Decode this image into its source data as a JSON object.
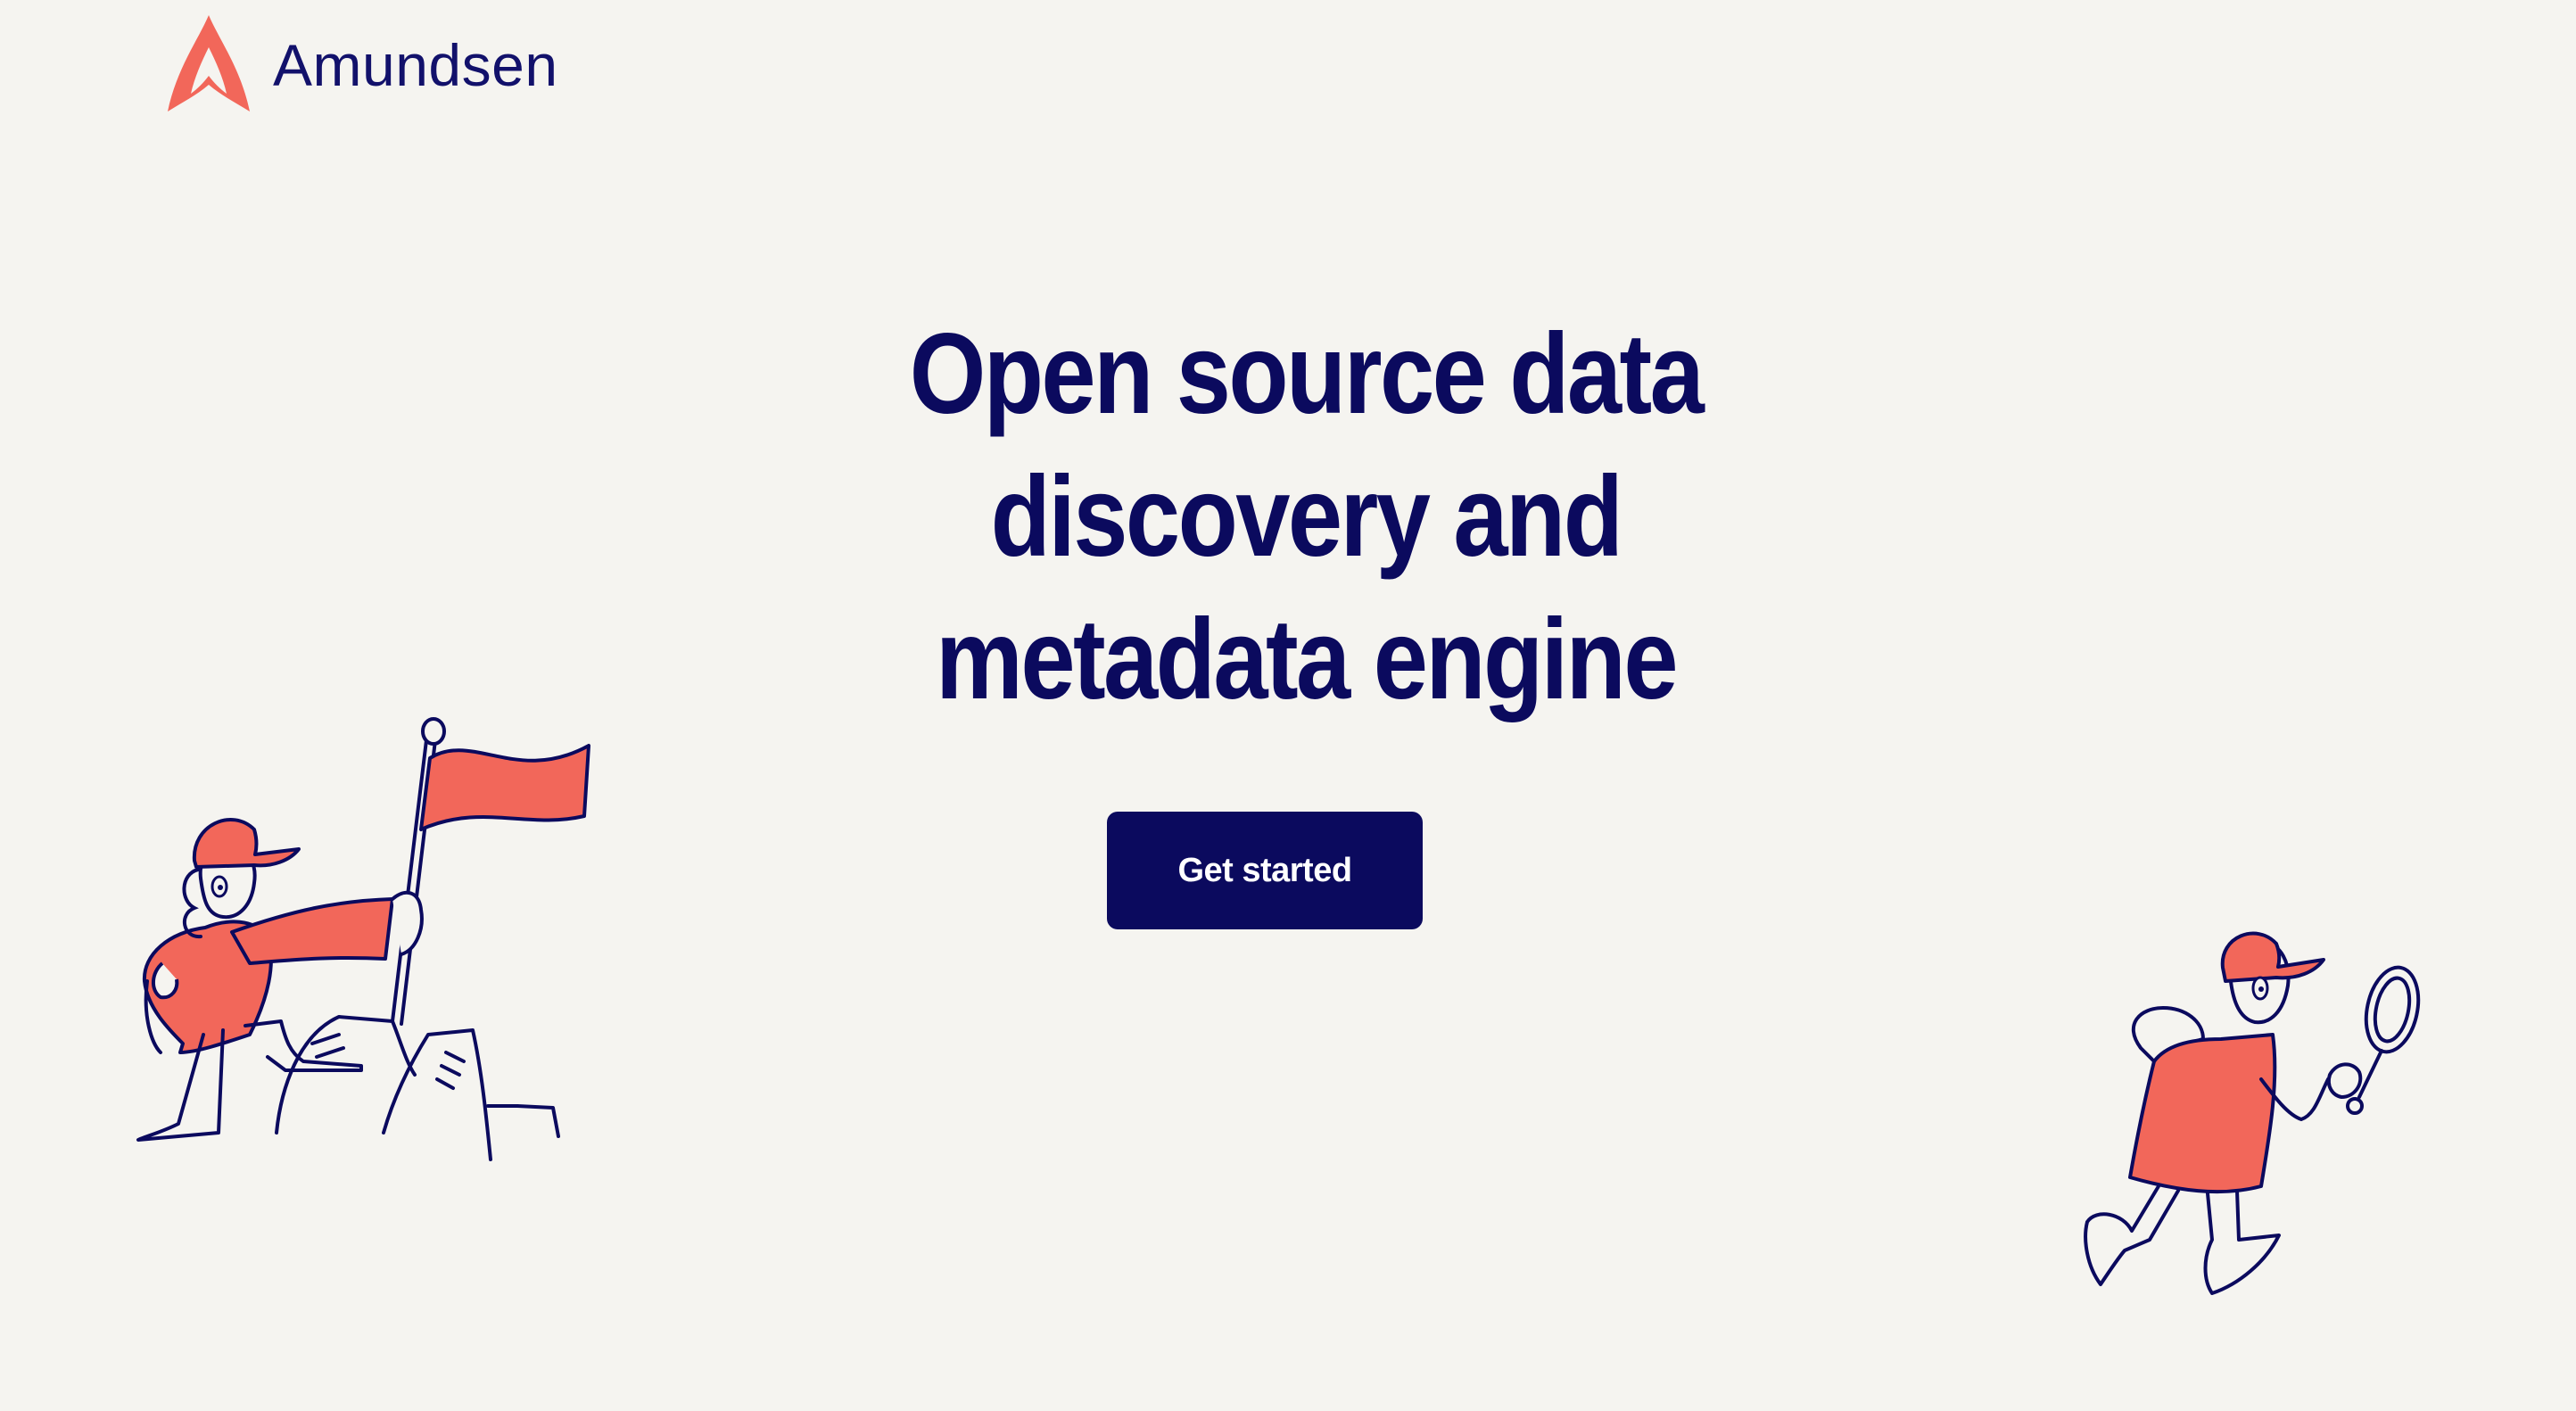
{
  "header": {
    "brand_name": "Amundsen",
    "logo_icon": "amundsen-logo-icon"
  },
  "hero": {
    "title_lines": [
      "Open source data",
      "discovery and",
      "metadata engine"
    ],
    "cta_label": "Get started"
  },
  "illustrations": {
    "left": "explorer-with-flag-illustration",
    "right": "explorer-with-magnifying-glass-illustration"
  },
  "colors": {
    "background": "#f5f4f0",
    "brand_navy": "#0b0a5e",
    "brand_coral": "#f2675a"
  }
}
